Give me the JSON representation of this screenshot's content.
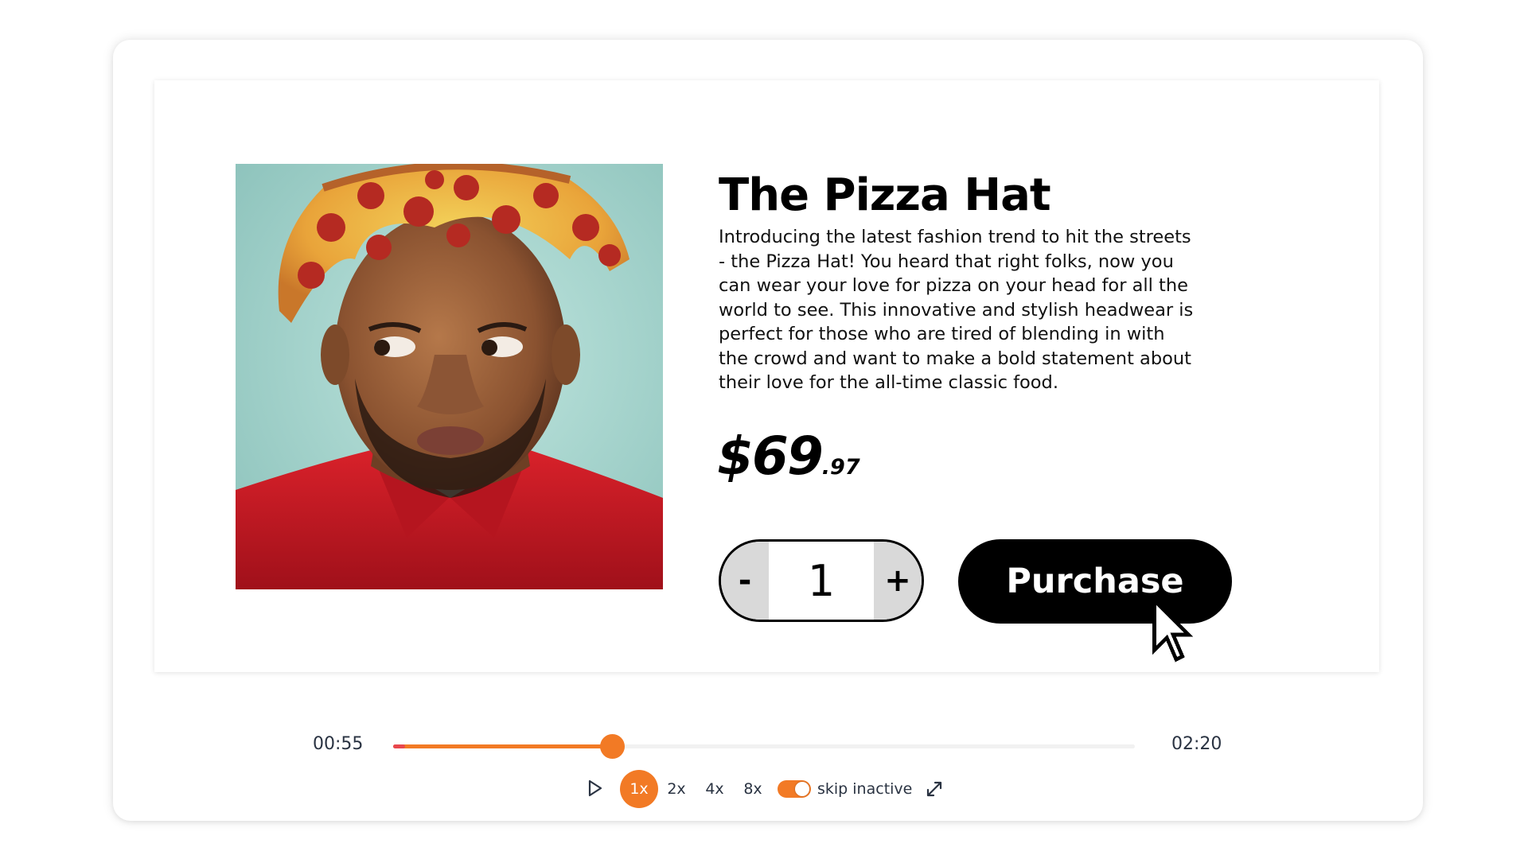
{
  "product": {
    "title": "The Pizza Hat",
    "description": "Introducing the latest fashion trend to hit the streets - the Pizza Hat! You heard that right folks, now you can wear your love for pizza on your head for all the world to see. This innovative and stylish headwear is perfect for those who are tired of blending in with the crowd and want to make a bold statement about their love for the all-time classic food.",
    "price_main": "$69",
    "price_cents": ".97",
    "image_icon": "product-photo"
  },
  "quantity": {
    "decrement_label": "-",
    "value": "1",
    "increment_label": "+"
  },
  "purchase": {
    "label": "Purchase"
  },
  "player": {
    "current_time": "00:55",
    "total_time": "02:20",
    "progress_fraction": 0.2952,
    "speeds": [
      "1x",
      "2x",
      "4x",
      "8x"
    ],
    "active_speed": "1x",
    "skip_inactive_label": "skip inactive",
    "skip_inactive_enabled": true,
    "accent_color": "#f27a25"
  }
}
